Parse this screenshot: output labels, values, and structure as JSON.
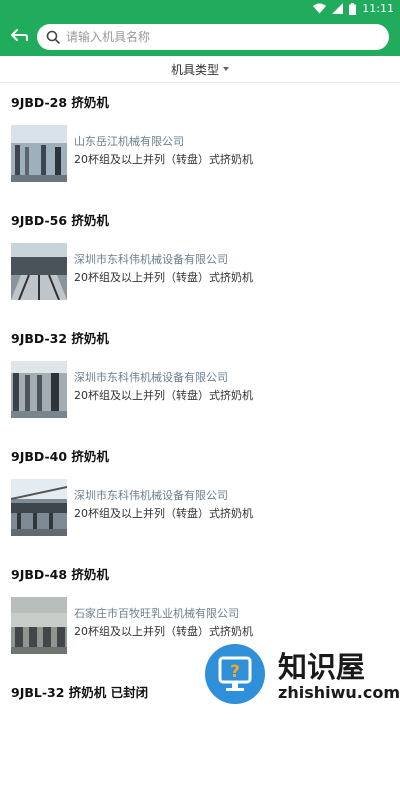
{
  "status": {
    "time": "11:11"
  },
  "search": {
    "placeholder": "请输入机具名称"
  },
  "filter": {
    "label": "机具类型"
  },
  "items": [
    {
      "model": "9JBD-28 挤奶机",
      "company": "山东岳江机械有限公司",
      "desc": "20杯组及以上并列（转盘）式挤奶机"
    },
    {
      "model": "9JBD-56 挤奶机",
      "company": "深圳市东科伟机械设备有限公司",
      "desc": "20杯组及以上并列（转盘）式挤奶机"
    },
    {
      "model": "9JBD-32 挤奶机",
      "company": "深圳市东科伟机械设备有限公司",
      "desc": "20杯组及以上并列（转盘）式挤奶机"
    },
    {
      "model": "9JBD-40 挤奶机",
      "company": "深圳市东科伟机械设备有限公司",
      "desc": "20杯组及以上并列（转盘）式挤奶机"
    },
    {
      "model": "9JBD-48 挤奶机",
      "company": "石家庄市百牧旺乳业机械有限公司",
      "desc": "20杯组及以上并列（转盘）式挤奶机"
    },
    {
      "model": "9JBL-32 挤奶机 已封闭",
      "company": "",
      "desc": ""
    }
  ],
  "watermark": {
    "name": "知识屋",
    "url": "zhishiwu.com"
  }
}
